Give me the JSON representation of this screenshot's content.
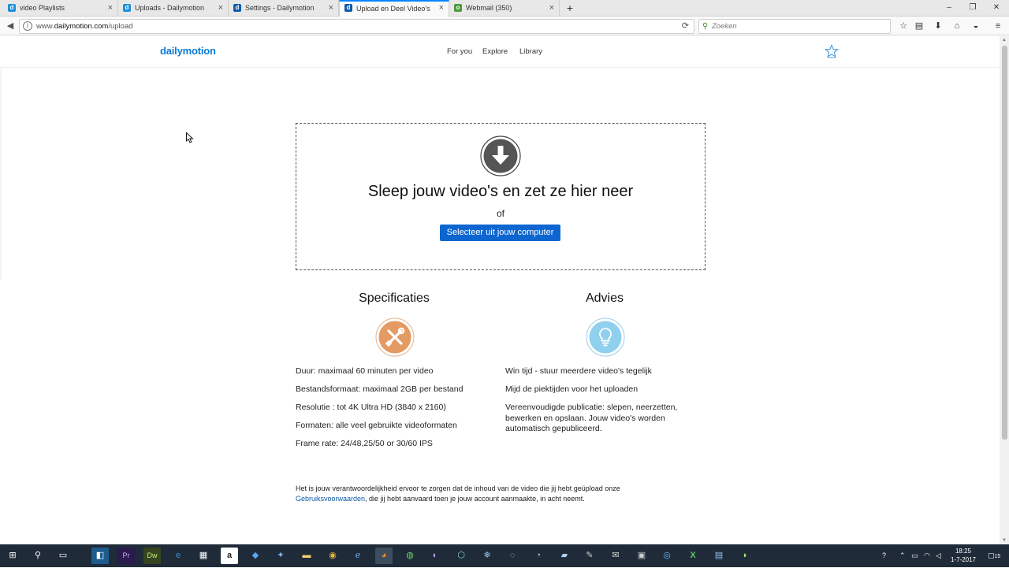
{
  "browser": {
    "tabs": [
      {
        "title": "video Playlists",
        "active": false,
        "fav_color": "#1a8fdb",
        "fav_glyph": "d"
      },
      {
        "title": "Uploads - Dailymotion",
        "active": false,
        "fav_color": "#1a8fdb",
        "fav_glyph": "d"
      },
      {
        "title": "Settings - Dailymotion",
        "active": false,
        "fav_color": "#0d5aa6",
        "fav_glyph": "d"
      },
      {
        "title": "Upload en Deel Video's | Dai",
        "active": true,
        "fav_color": "#0d5aa6",
        "fav_glyph": "d"
      },
      {
        "title": "Webmail (350)",
        "active": false,
        "fav_color": "#4a9a3a",
        "fav_glyph": "o"
      }
    ],
    "new_tab_label": "+",
    "close_label": "×",
    "window_controls": [
      "–",
      "❐",
      "✕"
    ],
    "url_prefix": "www.",
    "url_domain": "dailymotion.com",
    "url_path": "/upload",
    "search_placeholder": "Zoeken"
  },
  "site": {
    "logo": "dailymotion",
    "nav": [
      "For you",
      "Explore",
      "Library"
    ],
    "accent": "#0d66d0"
  },
  "upload": {
    "title": "Sleep jouw video's en zet ze hier neer",
    "or": "of",
    "button": "Selecteer uit jouw computer"
  },
  "specs": {
    "title": "Specificaties",
    "icon": "tools-icon",
    "items": [
      "Duur: maximaal 60 minuten per video",
      "Bestandsformaat: maximaal 2GB per bestand",
      "Resolutie : tot 4K Ultra HD (3840 x 2160)",
      "Formaten: alle veel gebruikte videoformaten",
      "Frame rate: 24/48,25/50 or 30/60 IPS"
    ]
  },
  "advice": {
    "title": "Advies",
    "icon": "lightbulb-icon",
    "items": [
      "Win tijd - stuur meerdere video's tegelijk",
      "Mijd de piektijden voor het uploaden",
      "Vereenvoudigde publicatie: slepen, neerzetten, bewerken en opslaan. Jouw video's worden automatisch gepubliceerd."
    ]
  },
  "footnote": {
    "before": "Het is jouw verantwoordelijkheid ervoor te zorgen dat de inhoud van de video die jij hebt geüpload onze ",
    "link": "Gebruiksvoorwaarden",
    "after": ", die jij hebt aanvaard toen je jouw account aanmaakte, in acht neemt."
  },
  "taskbar": {
    "time": "18:25",
    "date": "1-7-2017",
    "notification_count": "15"
  }
}
